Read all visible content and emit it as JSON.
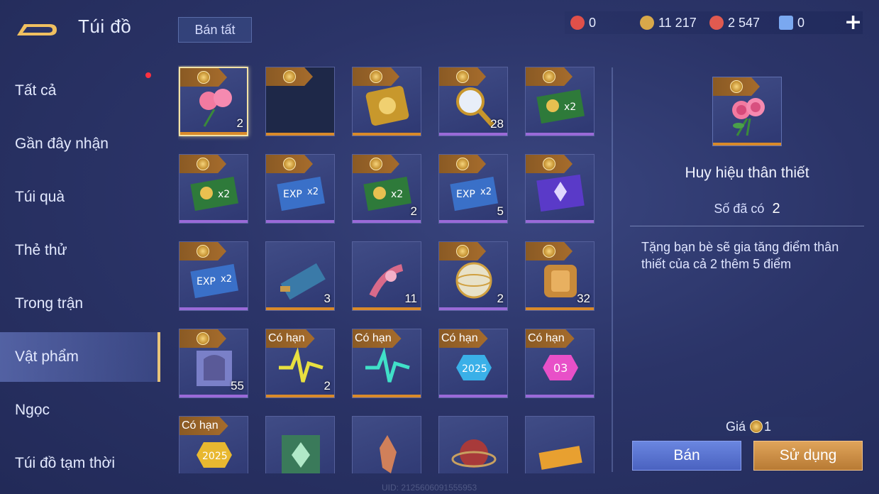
{
  "header": {
    "title": "Túi đồ",
    "sell_all_label": "Bán tất"
  },
  "currencies": [
    {
      "icon": "red-gem-icon",
      "value": "0",
      "color": "#e0504a"
    },
    {
      "icon": "gold-coin-icon",
      "value": "11 217",
      "color": "#d8a84a"
    },
    {
      "icon": "red-voucher-icon",
      "value": "2 547",
      "color": "#e05a50"
    },
    {
      "icon": "blue-card-icon",
      "value": "0",
      "color": "#7aa8f0"
    }
  ],
  "sidebar": {
    "items": [
      {
        "label": "Tất cả"
      },
      {
        "label": "Gần đây nhận"
      },
      {
        "label": "Túi quà"
      },
      {
        "label": "Thẻ thử"
      },
      {
        "label": "Trong trận"
      },
      {
        "label": "Vật phẩm"
      },
      {
        "label": "Ngọc"
      },
      {
        "label": "Túi đồ tạm thời"
      }
    ],
    "active_index": 5
  },
  "inventory": {
    "limited_label": "Có hạn",
    "items": [
      {
        "name": "pink-rose-item",
        "count": "2",
        "tag": "coin",
        "bar": "gold",
        "selected": true
      },
      {
        "name": "empty-dark-item",
        "count": "",
        "tag": "coin",
        "bar": "gold"
      },
      {
        "name": "gold-card-item",
        "count": "",
        "tag": "coin",
        "bar": "gold"
      },
      {
        "name": "magnifier-item",
        "count": "28",
        "tag": "coin",
        "bar": "purple"
      },
      {
        "name": "gold-x2-card-item",
        "count": "",
        "tag": "coin",
        "bar": "purple"
      },
      {
        "name": "gold-x2-card-item",
        "count": "",
        "tag": "coin",
        "bar": "purple"
      },
      {
        "name": "exp-x2-card-item",
        "count": "",
        "tag": "coin",
        "bar": "purple"
      },
      {
        "name": "gold-x2-card-item",
        "count": "2",
        "tag": "coin",
        "bar": "purple"
      },
      {
        "name": "exp-x2-card-item",
        "count": "5",
        "tag": "coin",
        "bar": "purple"
      },
      {
        "name": "purple-crystal-card-item",
        "count": "",
        "tag": "coin",
        "bar": "purple"
      },
      {
        "name": "exp-x2-card-item",
        "count": "",
        "tag": "coin",
        "bar": "purple"
      },
      {
        "name": "scroll-map-item",
        "count": "3",
        "tag": "none",
        "bar": "gold"
      },
      {
        "name": "flower-scroll-item",
        "count": "11",
        "tag": "none",
        "bar": "gold"
      },
      {
        "name": "gold-orb-item",
        "count": "2",
        "tag": "coin",
        "bar": "purple"
      },
      {
        "name": "gold-armor-item",
        "count": "32",
        "tag": "coin",
        "bar": "gold"
      },
      {
        "name": "silver-helmet-item",
        "count": "55",
        "tag": "coin",
        "bar": "purple"
      },
      {
        "name": "yellow-pulse-item",
        "count": "2",
        "tag": "limited",
        "bar": "gold"
      },
      {
        "name": "teal-pulse-item",
        "count": "",
        "tag": "limited",
        "bar": "gold"
      },
      {
        "name": "badge-2025-blue-item",
        "count": "",
        "tag": "limited",
        "bar": "purple"
      },
      {
        "name": "badge-03-pink-item",
        "count": "",
        "tag": "limited",
        "bar": "purple"
      },
      {
        "name": "badge-2025-gold-item",
        "count": "",
        "tag": "limited",
        "bar": "gold"
      },
      {
        "name": "green-emblem-item",
        "count": "",
        "tag": "none",
        "bar": "gold"
      },
      {
        "name": "crystal-shard-item",
        "count": "",
        "tag": "none",
        "bar": "gold"
      },
      {
        "name": "cosmic-orb-item",
        "count": "",
        "tag": "none",
        "bar": "gold"
      },
      {
        "name": "anniversary-ticket-item",
        "count": "",
        "tag": "none",
        "bar": "gold"
      }
    ]
  },
  "detail": {
    "name": "Huy hiệu thân thiết",
    "owned_label": "Số đã có",
    "owned_value": "2",
    "description": "Tặng bạn bè sẽ gia tăng điểm thân thiết của cả 2 thêm 5 điểm",
    "price_label": "Giá",
    "price_value": "1",
    "sell_label": "Bán",
    "use_label": "Sử dụng"
  },
  "uid_text": "UID: 2125606091555953"
}
